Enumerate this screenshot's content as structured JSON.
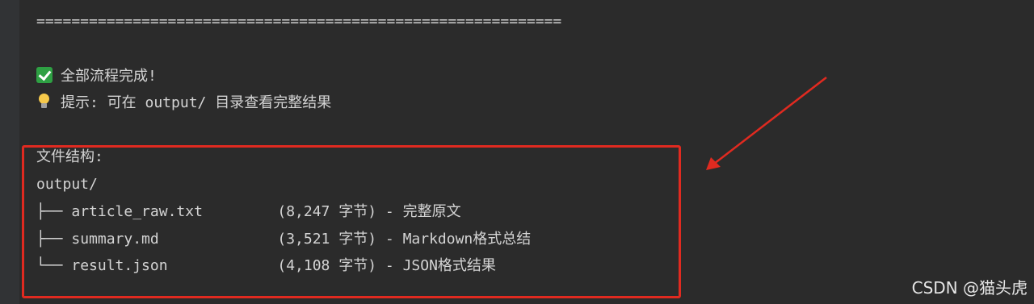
{
  "console": {
    "separator": "============================================================",
    "done_message": "全部流程完成!",
    "hint_message": "提示: 可在 output/ 目录查看完整结果",
    "tree_title": "文件结构:",
    "tree_root": "output/",
    "tree_items": [
      {
        "branch": "├── ",
        "name": "article_raw.txt",
        "info": "(8,247 字节) - 完整原文"
      },
      {
        "branch": "├── ",
        "name": "summary.md",
        "info": "(3,521 字节) - Markdown格式总结"
      },
      {
        "branch": "└── ",
        "name": "result.json",
        "info": "(4,108 字节) - JSON格式结果"
      }
    ]
  },
  "icons": {
    "done": "check-mark-icon",
    "hint": "light-bulb-icon"
  },
  "annotation": {
    "box_color": "#e02a20",
    "arrow_color": "#e02a20"
  },
  "watermark": "CSDN @猫头虎"
}
